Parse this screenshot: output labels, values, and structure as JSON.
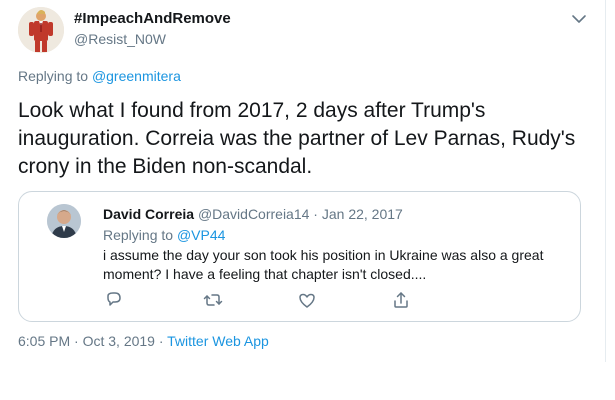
{
  "tweet": {
    "display_name": "#ImpeachAndRemove",
    "handle": "@Resist_N0W",
    "replying_to_prefix": "Replying to",
    "replying_to_handle": "@greenmitera",
    "text": "Look what I found from 2017, 2 days after Trump's inauguration. Correia was the partner of Lev Parnas, Rudy's crony in the Biden non-scandal.",
    "timestamp": "6:05 PM · Oct 3, 2019 · ",
    "source": "Twitter Web App"
  },
  "quoted": {
    "display_name": "David Correia",
    "handle": "@DavidCorreia14",
    "date": " · Jan 22, 2017",
    "replying_to_prefix": "Replying to",
    "replying_to_handle": "@VP44",
    "text": "i assume the day your son took his position in Ukraine was also a great moment? I have a feeling that chapter isn't closed....",
    "actions": [
      "reply-icon",
      "retweet-icon",
      "like-icon",
      "share-icon"
    ]
  },
  "colors": {
    "link": "#1b95e0",
    "secondary_text": "#657786",
    "border": "#ccd6dd"
  }
}
